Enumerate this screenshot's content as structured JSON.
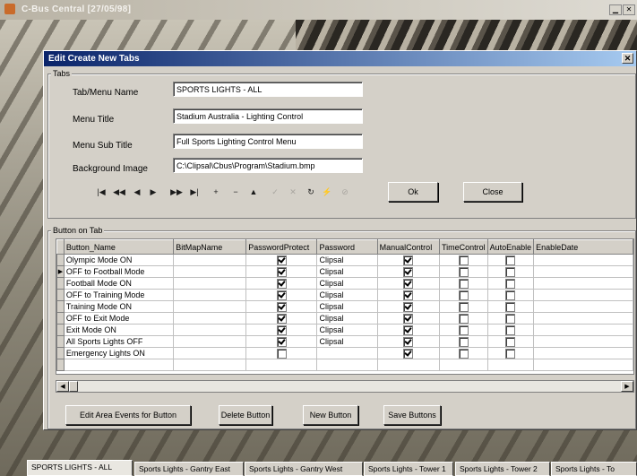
{
  "window": {
    "title": "C-Bus Central  [27/05/98]",
    "min_icon": "minimize-icon",
    "close_icon": "close-icon"
  },
  "dialog": {
    "title": "Edit Create New Tabs",
    "close_label": "✕",
    "tabs_group_label": "Tabs",
    "fields": {
      "tab_menu_name": {
        "label": "Tab/Menu Name",
        "value": "SPORTS LIGHTS - ALL"
      },
      "menu_title": {
        "label": "Menu Title",
        "value": "Stadium Australia - Lighting Control"
      },
      "menu_sub_title": {
        "label": "Menu Sub Title",
        "value": "Full Sports Lighting Control Menu"
      },
      "background_image": {
        "label": "Background Image",
        "value": "C:\\Clipsal\\Cbus\\Program\\Stadium.bmp"
      }
    },
    "navigator": [
      {
        "name": "first-record",
        "glyph": "|◀",
        "enabled": true
      },
      {
        "name": "prior-page",
        "glyph": "◀◀",
        "enabled": true
      },
      {
        "name": "prior-record",
        "glyph": "◀",
        "enabled": true
      },
      {
        "name": "next-record",
        "glyph": "▶",
        "enabled": true
      },
      {
        "name": "next-page",
        "glyph": "▶▶",
        "enabled": true
      },
      {
        "name": "last-record",
        "glyph": "▶|",
        "enabled": true
      },
      {
        "name": "insert-record",
        "glyph": "+",
        "enabled": true
      },
      {
        "name": "delete-record",
        "glyph": "−",
        "enabled": true
      },
      {
        "name": "edit-record",
        "glyph": "▲",
        "enabled": true
      },
      {
        "name": "post-edit",
        "glyph": "✓",
        "enabled": false
      },
      {
        "name": "cancel-edit",
        "glyph": "✕",
        "enabled": false
      },
      {
        "name": "refresh-data",
        "glyph": "↻",
        "enabled": true
      },
      {
        "name": "apply-updates",
        "glyph": "⚡",
        "enabled": true
      },
      {
        "name": "cancel-updates",
        "glyph": "⊘",
        "enabled": false
      }
    ],
    "ok_label": "Ok",
    "close_button_label": "Close",
    "buttons_group_label": "Button on Tab",
    "grid": {
      "columns": [
        "Button_Name",
        "BitMapName",
        "PasswordProtect",
        "Password",
        "ManualControl",
        "TimeControl",
        "AutoEnable",
        "EnableDate"
      ],
      "rows": [
        {
          "name": "Olympic Mode ON",
          "bitmap": "",
          "pp": true,
          "password": "Clipsal",
          "manual": true,
          "time": false,
          "auto": false,
          "date": ""
        },
        {
          "name": "OFF to Football Mode",
          "bitmap": "",
          "pp": true,
          "password": "Clipsal",
          "manual": true,
          "time": false,
          "auto": false,
          "date": "",
          "current": true
        },
        {
          "name": "Football Mode ON",
          "bitmap": "",
          "pp": true,
          "password": "Clipsal",
          "manual": true,
          "time": false,
          "auto": false,
          "date": ""
        },
        {
          "name": "OFF to Training Mode",
          "bitmap": "",
          "pp": true,
          "password": "Clipsal",
          "manual": true,
          "time": false,
          "auto": false,
          "date": ""
        },
        {
          "name": "Training Mode ON",
          "bitmap": "",
          "pp": true,
          "password": "Clipsal",
          "manual": true,
          "time": false,
          "auto": false,
          "date": ""
        },
        {
          "name": "OFF to Exit Mode",
          "bitmap": "",
          "pp": true,
          "password": "Clipsal",
          "manual": true,
          "time": false,
          "auto": false,
          "date": ""
        },
        {
          "name": "Exit Mode ON",
          "bitmap": "",
          "pp": true,
          "password": "Clipsal",
          "manual": true,
          "time": false,
          "auto": false,
          "date": ""
        },
        {
          "name": "All Sports Lights OFF",
          "bitmap": "",
          "pp": true,
          "password": "Clipsal",
          "manual": true,
          "time": false,
          "auto": false,
          "date": ""
        },
        {
          "name": "Emergency Lights ON",
          "bitmap": "",
          "pp": false,
          "password": "",
          "manual": true,
          "time": false,
          "auto": false,
          "date": ""
        }
      ]
    },
    "action_buttons": {
      "edit_area_events": "Edit Area Events for Button",
      "delete_button": "Delete Button",
      "new_button": "New Button",
      "save_buttons": "Save Buttons"
    }
  },
  "tabstrip": [
    {
      "label": "SPORTS LIGHTS - ALL",
      "active": true
    },
    {
      "label": "Sports Lights - Gantry East",
      "active": false
    },
    {
      "label": "Sports Lights - Gantry West",
      "active": false
    },
    {
      "label": "Sports Lights - Tower 1",
      "active": false
    },
    {
      "label": "Sports Lights - Tower 2",
      "active": false
    },
    {
      "label": "Sports Lights - To",
      "active": false
    }
  ],
  "colors": {
    "title_active": "#0a246a",
    "face": "#d4d0c8"
  }
}
